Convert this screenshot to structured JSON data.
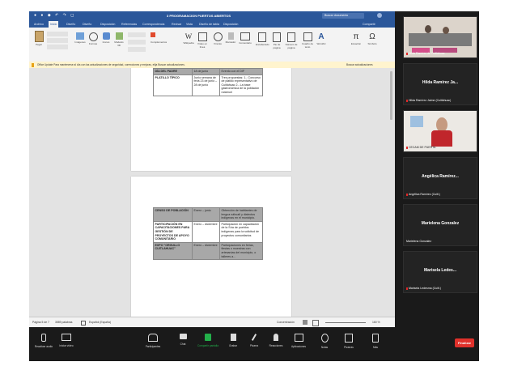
{
  "titlebar": {
    "title": "3 PROGRAMACION PUERTOS ABIERTOS",
    "search_placeholder": "Buscar documento"
  },
  "tabs": [
    "Archivo",
    "Inicio",
    "Diseño",
    "Diseño",
    "Disposición",
    "Referencias",
    "Correspondencia",
    "Revisar",
    "Vista",
    "Diseño de tabla",
    "Disposición"
  ],
  "share_label": "Compartir",
  "ribbon": {
    "buttons": [
      "Pegar",
      "Imágenes",
      "Formas",
      "Iconos",
      "Modelos 3D",
      "Complementos",
      "Wikipedia",
      "Vídeo en línea",
      "Vínculo",
      "Marcador",
      "Comentario",
      "Encabezado",
      "Pie de página",
      "Número de página",
      "Cuadro de texto",
      "WordArt",
      "Ecuación",
      "Símbolo"
    ]
  },
  "info_bar": {
    "text": "Office Update  Para mantenerse al día con las actualizaciones de seguridad, correcciones y mejoras, elija Buscar actualizaciones.",
    "action": "Buscar actualizaciones"
  },
  "doc_page1": {
    "rows": [
      [
        "DÍA DEL PADRE",
        "18 de junio",
        "Evento con el DIF"
      ],
      [
        "PLATILLO TÍPICO",
        "Junio semana de feria 23 de junio – 28 de junio",
        "Tres propuestas: 1.- Concurso de platillo representativo de Cuitláhuac 2.- La base gastronómica de la población rarámuri"
      ]
    ]
  },
  "doc_page2": {
    "rows": [
      [
        "CENSO DE POBLACIÓN",
        "Enero – junio",
        "Obtención de habitantes de lengua náhuatl y dialectos indígenas en el municipio."
      ],
      [
        "PARTICIPACIÓN EN CAPACITACIONES PARA GESTIÓN DE PROYECTOS DE APOYO COMUNITARIO",
        "Enero – diciembre",
        "Participación en capacitación de la Sría de pueblos indígenas para la solicitud de proyectos comunitarios"
      ],
      [
        "EXPO \"ORGULLO CUITLAHUAC\"",
        "Enero – diciembre",
        "Participaciones en ferias, fiestas o muestras con artesanías del municipio, o talleres a..."
      ]
    ]
  },
  "statusbar": {
    "page": "Página 5 de 7",
    "words": "3589 palabras",
    "language": "Español (España)",
    "focus": "Concentración",
    "zoom": "160 %"
  },
  "participants": [
    {
      "name": "",
      "label": "Hilda Ramírez de Cuitláhuac",
      "has_video": true
    },
    {
      "name": "Hilda Ramírez Ja...",
      "label": "Hilda Ramírez Jaime (Cuitláhuac)",
      "has_video": false
    },
    {
      "name": "",
      "label": "CECAM DE PUERTA",
      "has_video": true
    },
    {
      "name": "Angélica Ramírez...",
      "label": "Angélica Ramírez (Cuitl.)",
      "has_video": false
    },
    {
      "name": "Marielena Gonzalez",
      "label": "Marielena Gonzalez",
      "has_video": false
    },
    {
      "name": "Marisela Ledes...",
      "label": "Marisela Ledesma (Cuitl.)",
      "has_video": false
    }
  ],
  "toolbar": {
    "left": [
      "Reactivar audio",
      "Iniciar vídeo"
    ],
    "center": [
      "Participantes",
      "Chat",
      "Compartir pantalla",
      "Grabar",
      "Pizarra",
      "Reacciones",
      "Aplicaciones",
      "Notas",
      "Pizarras",
      "Más"
    ],
    "end_label": "Finalizar"
  },
  "colors": {
    "word_blue": "#2b579a",
    "shade": "#a8a8a8",
    "share_green": "#23b04a",
    "end_red": "#e0312b",
    "mic_red": "#e02828"
  }
}
